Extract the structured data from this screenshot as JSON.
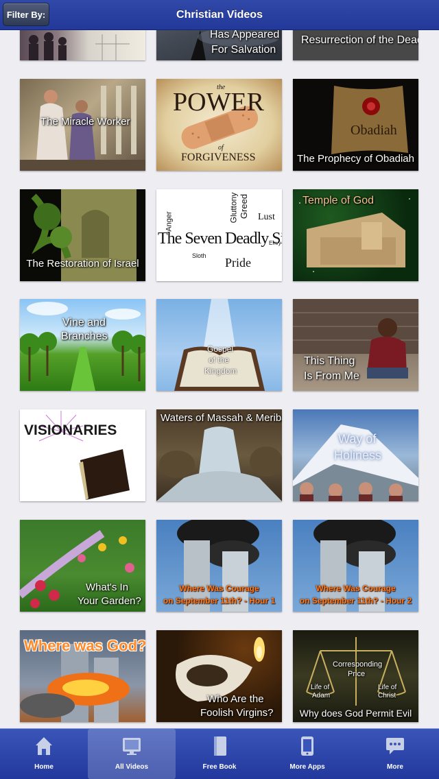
{
  "nav": {
    "title": "Christian Videos",
    "filter_label": "Filter By:"
  },
  "videos": [
    {
      "title": "Has Appeared For Salvation",
      "line1": "Has Appeared",
      "line2": "For Salvation"
    },
    {
      "title": "Resurrection of the Dead"
    },
    {
      "title": "The Miracle Worker"
    },
    {
      "title": "The Power of Forgiveness",
      "line_the": "the",
      "line_power": "POWER",
      "line_of": "of",
      "line_forgiveness": "FORGIVENESS"
    },
    {
      "title": "Obadiah",
      "subtitle": "The Prophecy of Obadiah"
    },
    {
      "title": "The Restoration of Israel"
    },
    {
      "title": "The Seven Deadly Sins",
      "words": [
        "Anger",
        "Gluttony",
        "Greed",
        "Lust",
        "Envy",
        "Sloth",
        "Pride"
      ]
    },
    {
      "title": "Temple of God"
    },
    {
      "title": "Vine and Branches",
      "line1": "Vine and",
      "line2": "Branches"
    },
    {
      "title": "Gospel of the Kingdom",
      "line1": "Gospel",
      "line2": "of the",
      "line3": "Kingdom"
    },
    {
      "title": "This Thing Is From Me",
      "line1": "This Thing",
      "line2": "Is From Me"
    },
    {
      "title": "VISIONARIES"
    },
    {
      "title": "Waters of Massah & Meribah"
    },
    {
      "title": "Way of Holiness",
      "line1": "Way of",
      "line2": "Holiness"
    },
    {
      "title": "What's In Your Garden?",
      "line1": "What's In",
      "line2": "Your Garden?"
    },
    {
      "title": "Where Was Courage on September 11th? - Hour 1",
      "line1": "Where Was Courage",
      "line2": "on September 11th? - Hour 1"
    },
    {
      "title": "Where Was Courage on September 11th? - Hour 2",
      "line1": "Where Was Courage",
      "line2": "on September 11th? - Hour 2"
    },
    {
      "title": "Where was God?"
    },
    {
      "title": "Who Are the Foolish Virgins?",
      "line1": "Who Are the",
      "line2": "Foolish Virgins?"
    },
    {
      "title": "Why does God Permit Evil",
      "corresponding": "Corresponding",
      "price": "Price",
      "adam1": "Life of",
      "adam2": "Adam",
      "christ1": "Life of",
      "christ2": "Christ"
    }
  ],
  "tabs": [
    {
      "label": "Home",
      "icon": "home-icon",
      "active": false
    },
    {
      "label": "All Videos",
      "icon": "monitor-icon",
      "active": true
    },
    {
      "label": "Free Book",
      "icon": "book-icon",
      "active": false
    },
    {
      "label": "More Apps",
      "icon": "tablet-icon",
      "active": false
    },
    {
      "label": "More",
      "icon": "chat-bubble-icon",
      "active": false
    }
  ],
  "colors": {
    "nav_bar": "#23399a",
    "tab_bar": "#22389c",
    "background": "#ededf2"
  }
}
